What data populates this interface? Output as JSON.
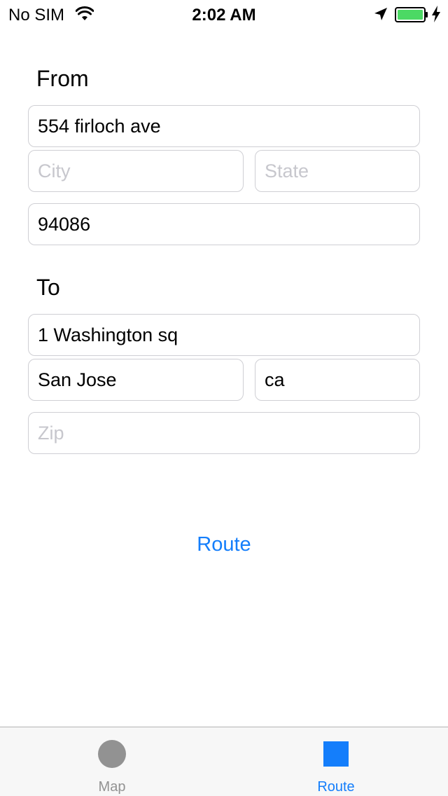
{
  "status_bar": {
    "carrier": "No SIM",
    "time": "2:02 AM",
    "battery_color": "#4cd964"
  },
  "from": {
    "heading": "From",
    "street_value": "554 firloch ave",
    "city_placeholder": "City",
    "state_placeholder": "State",
    "zip_value": "94086"
  },
  "to": {
    "heading": "To",
    "street_value": "1 Washington sq",
    "city_value": "San Jose",
    "state_value": "ca",
    "zip_placeholder": "Zip"
  },
  "route_button_label": "Route",
  "tab_bar": {
    "tabs": [
      {
        "label": "Map",
        "icon": "circle-icon",
        "color": "#929292",
        "selected": false
      },
      {
        "label": "Route",
        "icon": "square-icon",
        "color": "#147efb",
        "selected": true
      }
    ]
  },
  "colors": {
    "accent": "#147efb",
    "placeholder": "#c7c7cd",
    "inactive_tab": "#929292"
  }
}
